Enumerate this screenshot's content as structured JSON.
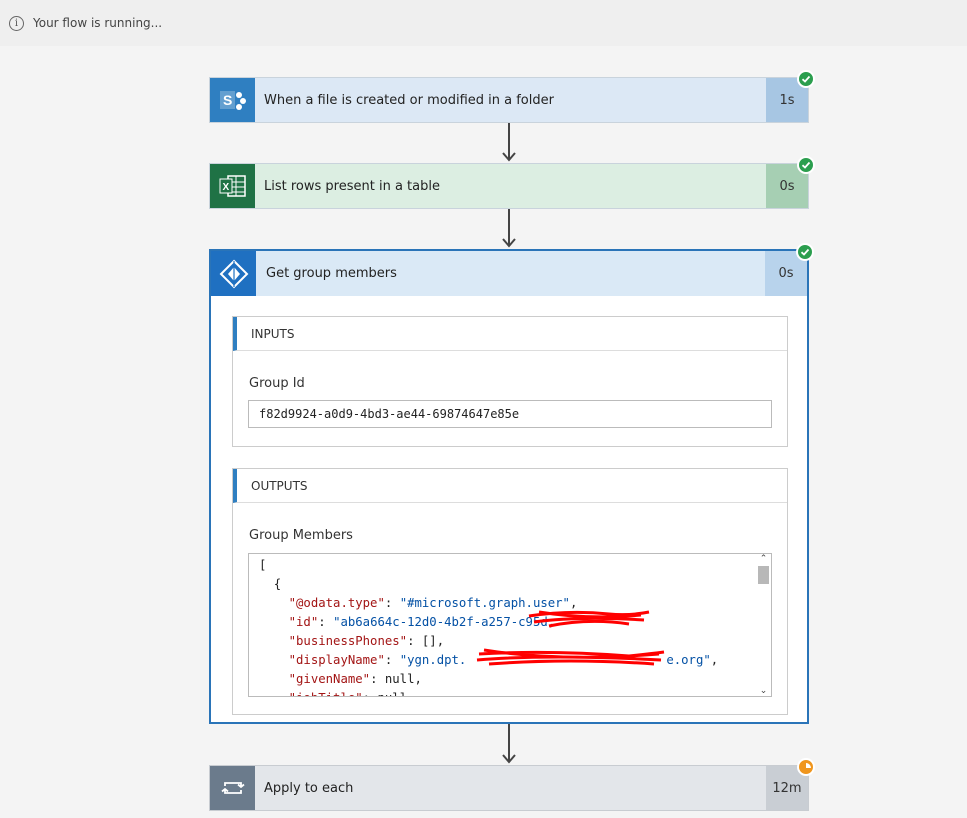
{
  "status_bar": {
    "icon": "info-icon",
    "text": "Your flow is running..."
  },
  "steps": [
    {
      "title": "When a file is created or modified in a folder",
      "duration": "1s",
      "icon": "sharepoint-icon",
      "status": "succeeded",
      "color": "#2f7fc1",
      "bg": "#dce8f5",
      "dur_bg": "#a7c6e3"
    },
    {
      "title": "List rows present in a table",
      "duration": "0s",
      "icon": "excel-icon",
      "status": "succeeded",
      "color": "#1f7245",
      "bg": "#dceee2",
      "dur_bg": "#a6cfb3"
    },
    {
      "title": "Get group members",
      "duration": "0s",
      "icon": "azure-ad-icon",
      "status": "succeeded",
      "color": "#1f70c1"
    },
    {
      "title": "Apply to each",
      "duration": "12m",
      "icon": "loop-icon",
      "status": "running",
      "color": "#6b7b8c",
      "bg": "#e3e6ea",
      "dur_bg": "#c9ced4"
    }
  ],
  "inputs": {
    "header": "INPUTS",
    "group_id_label": "Group Id",
    "group_id_value": "f82d9924-a0d9-4bd3-ae44-69874647e85e"
  },
  "outputs": {
    "header": "OUTPUTS",
    "label": "Group Members",
    "json_lines": [
      {
        "text": "["
      },
      {
        "text": "  {"
      },
      {
        "key": "\"@odata.type\"",
        "value": "\"#microsoft.graph.user\"",
        "tail": ","
      },
      {
        "key": "\"id\"",
        "value": "\"ab6a664c-12d0-4b2f-a257-c95d",
        "tail": ","
      },
      {
        "key": "\"businessPhones\"",
        "plain": "[]",
        "tail": ","
      },
      {
        "key": "\"displayName\"",
        "value": "\"ygn.dpt.",
        "value2": "e.org\"",
        "tail": ","
      },
      {
        "key": "\"givenName\"",
        "plain": "null",
        "tail": ","
      },
      {
        "key": "\"jobTitle\"",
        "plain": "null",
        "tail": ""
      }
    ]
  },
  "colors": {
    "success": "#2b9e4e",
    "running": "#f0961e",
    "selected_border": "#2a74b8"
  }
}
